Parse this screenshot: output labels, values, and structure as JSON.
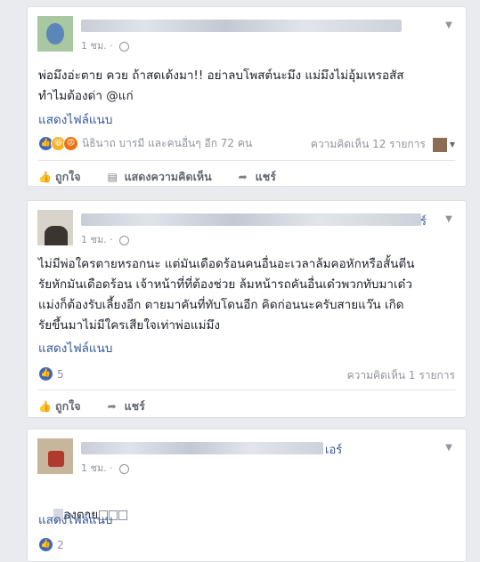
{
  "posts": [
    {
      "time": "1 ชม.",
      "text": "พ่อมึงอ่ะตาย ควย ถ้าสดเด้งมา!! อย่าลบโพสต์นะมึง แม่มึงไม่อุ้มเหรอสัส\nทำไมต้องด่า @แก่",
      "attach": "แสดงไฟล์แนบ",
      "reactions": "นิธินาถ บารมี และคนอื่นๆ อีก 72 คน",
      "comments": "ความคิดเห็น 12 รายการ",
      "actions": {
        "like": "ถูกใจ",
        "comment": "แสดงความคิดเห็น",
        "share": "แชร์"
      }
    },
    {
      "name_suffix": "ร์",
      "time": "1 ชม.",
      "text": "ไม่มีพ่อใครตายหรอกนะ แต่มันเดือดร้อนคนอื่นอะเวลาล้มคอหักหรือสั้นตีน\nรัยหักมันเดือดร้อน เจ้าหน้าที่ที่ต้องช่วย ล้มหน้ารถคันอื่นเด๋วพวกทับมาเด๋ว\nแม่งก็ต้องรับเลี้ยงอีก ตายมาคันที่ทับโดนอีก คิดก่อนนะครับสายแว๊น เกิด\nรัยขึ้นมาไม่มีใครเสียใจเท่าพ่อแม่มึง",
      "attach": "แสดงไฟล์แนบ",
      "likes": "5",
      "comments": "ความคิดเห็น 1 รายการ",
      "actions": {
        "like": "ถูกใจ",
        "share": "แชร์"
      }
    },
    {
      "name_suffix": "เอร์",
      "time": "1 ชม.",
      "text": "องตาย",
      "attach": "แสดงไฟล์แนบ",
      "likes": "2"
    }
  ],
  "colors": {
    "link": "#365899",
    "like_blue": "#4267b2",
    "meta": "#90949c"
  }
}
